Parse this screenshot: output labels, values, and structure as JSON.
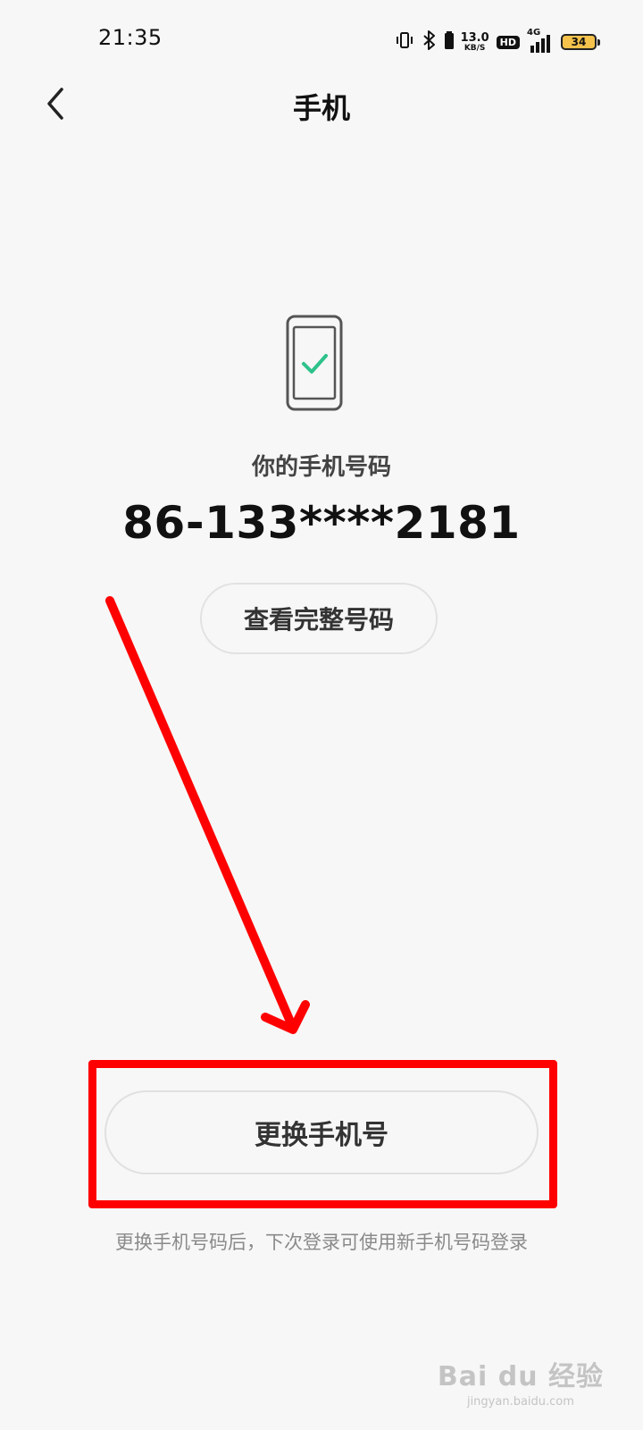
{
  "status_bar": {
    "time": "21:35",
    "net_speed_value": "13.0",
    "net_speed_unit": "KB/S",
    "hd_label": "HD",
    "network_label": "4G",
    "battery_level": "34"
  },
  "nav": {
    "title": "手机"
  },
  "main": {
    "phone_label": "你的手机号码",
    "phone_number": "86-133****2181",
    "view_full_label": "查看完整号码",
    "change_button_label": "更换手机号",
    "hint": "更换手机号码后，下次登录可使用新手机号码登录"
  },
  "watermark": {
    "main": "Bai du 经验",
    "sub": "jingyan.baidu.com"
  },
  "colors": {
    "accent_check": "#2ec28b",
    "annotation_red": "#ff0000",
    "battery_fill": "#f5c24c"
  }
}
